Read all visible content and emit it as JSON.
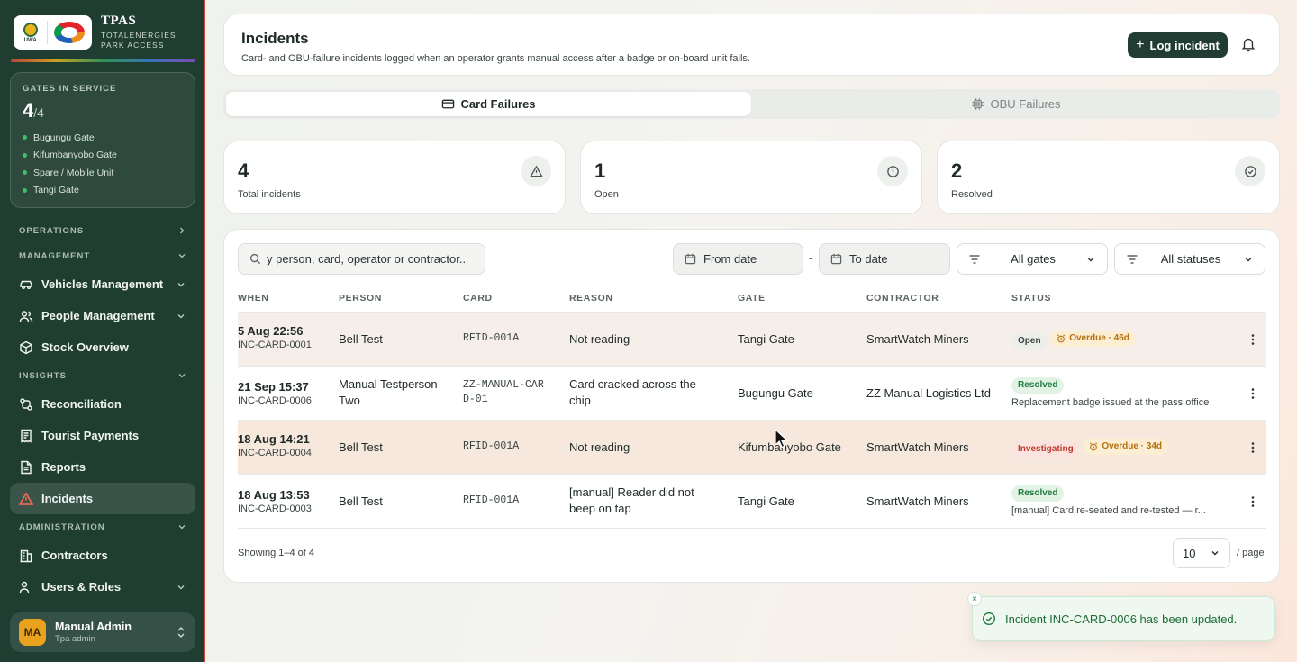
{
  "brand": {
    "logo_uwa_text": "UWA",
    "title": "TPAS",
    "subtitle_line1": "TOTALENERGIES",
    "subtitle_line2": "PARK ACCESS"
  },
  "gates": {
    "label": "GATES IN SERVICE",
    "active": "4",
    "total": "/4",
    "items": [
      "Bugungu Gate",
      "Kifumbanyobo Gate",
      "Spare / Mobile Unit",
      "Tangi Gate"
    ]
  },
  "nav": {
    "operations": "OPERATIONS",
    "management": "MANAGEMENT",
    "vehicles": "Vehicles Management",
    "people": "People Management",
    "stock": "Stock Overview",
    "insights": "INSIGHTS",
    "reconciliation": "Reconciliation",
    "tourist_payments": "Tourist Payments",
    "reports": "Reports",
    "incidents": "Incidents",
    "administration": "ADMINISTRATION",
    "contractors": "Contractors",
    "users_roles": "Users & Roles"
  },
  "user": {
    "initials": "MA",
    "name": "Manual Admin",
    "role": "Tpa admin"
  },
  "header": {
    "title": "Incidents",
    "description": "Card- and OBU-failure incidents logged when an operator grants manual access after a badge or on-board unit fails.",
    "log_button": "Log incident"
  },
  "tabs": {
    "card": "Card Failures",
    "obu": "OBU Failures"
  },
  "stats": {
    "total_value": "4",
    "total_label": "Total incidents",
    "open_value": "1",
    "open_label": "Open",
    "resolved_value": "2",
    "resolved_label": "Resolved"
  },
  "filters": {
    "search_value": "y person, card, operator or contractor..",
    "from_date": "From date",
    "separator": "-",
    "to_date": "To date",
    "gates": "All gates",
    "statuses": "All statuses"
  },
  "table": {
    "headers": {
      "when": "WHEN",
      "person": "PERSON",
      "card": "CARD",
      "reason": "REASON",
      "gate": "GATE",
      "contractor": "CONTRACTOR",
      "status": "STATUS"
    },
    "rows": [
      {
        "when": "5 Aug 22:56",
        "id": "INC-CARD-0001",
        "person": "Bell Test",
        "card": "RFID-001A",
        "reason": "Not reading",
        "gate": "Tangi Gate",
        "contractor": "SmartWatch Miners",
        "status": "Open",
        "overdue": "Overdue · 46d",
        "note": ""
      },
      {
        "when": "21 Sep 15:37",
        "id": "INC-CARD-0006",
        "person": "Manual Testperson Two",
        "card": "ZZ-MANUAL-CARD-01",
        "reason": "Card cracked across the chip",
        "gate": "Bugungu Gate",
        "contractor": "ZZ Manual Logistics Ltd",
        "status": "Resolved",
        "overdue": "",
        "note": "Replacement badge issued at the pass office"
      },
      {
        "when": "18 Aug 14:21",
        "id": "INC-CARD-0004",
        "person": "Bell Test",
        "card": "RFID-001A",
        "reason": "Not reading",
        "gate": "Kifumbanyobo Gate",
        "contractor": "SmartWatch Miners",
        "status": "Investigating",
        "overdue": "Overdue · 34d",
        "note": ""
      },
      {
        "when": "18 Aug 13:53",
        "id": "INC-CARD-0003",
        "person": "Bell Test",
        "card": "RFID-001A",
        "reason": "[manual] Reader did not beep on tap",
        "gate": "Tangi Gate",
        "contractor": "SmartWatch Miners",
        "status": "Resolved",
        "overdue": "",
        "note": "[manual] Card re-seated and re-tested — r..."
      }
    ]
  },
  "footer": {
    "showing": "Showing 1–4 of 4",
    "page_size": "10",
    "per_page": "/ page"
  },
  "toast": {
    "close": "×",
    "message": "Incident INC-CARD-0006 has been updated."
  }
}
